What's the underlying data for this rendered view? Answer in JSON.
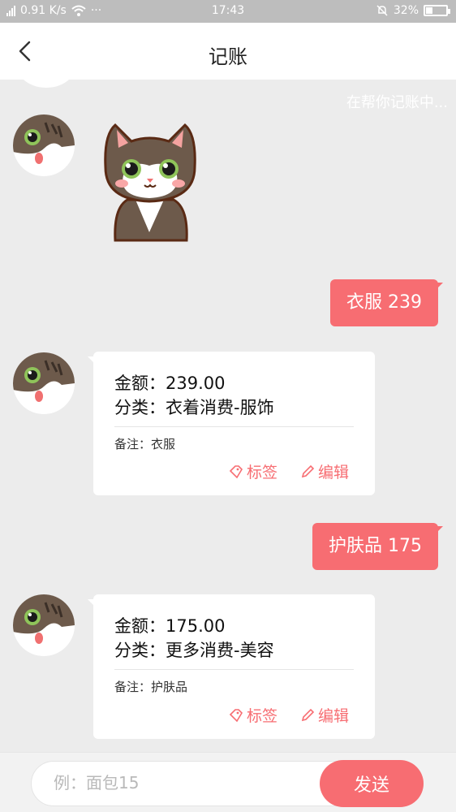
{
  "status_bar": {
    "network_type": "4G",
    "speed": "0.91 K/s",
    "more": "···",
    "time": "17:43",
    "battery": "32%",
    "battery_level": 0.32
  },
  "header": {
    "title": "记账"
  },
  "chat": {
    "typing_text": "在帮你记账中...",
    "messages": [
      {
        "type": "sticker",
        "from": "bot"
      },
      {
        "type": "user",
        "text": "衣服 239"
      },
      {
        "type": "card",
        "amount_line": "金额：239.00",
        "category_line": "分类：衣着消费-服饰",
        "note_line": "备注：衣服",
        "tag_label": "标签",
        "edit_label": "编辑"
      },
      {
        "type": "user",
        "text": "护肤品 175"
      },
      {
        "type": "card",
        "amount_line": "金额：175.00",
        "category_line": "分类：更多消费-美容",
        "note_line": "备注：护肤品",
        "tag_label": "标签",
        "edit_label": "编辑"
      }
    ]
  },
  "input": {
    "placeholder": "例：面包15",
    "value": "",
    "send_label": "发送"
  },
  "colors": {
    "accent": "#f76d72",
    "background": "#ececec",
    "status_bar": "#bdbdbd"
  }
}
